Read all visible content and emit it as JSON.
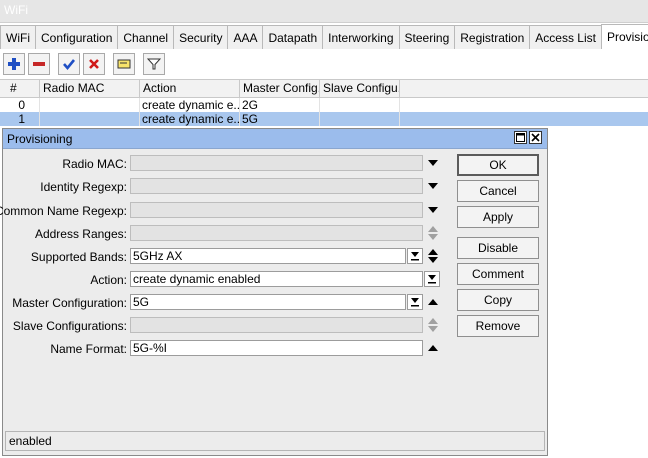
{
  "window": {
    "title": "WiFi"
  },
  "tabs": [
    {
      "label": "WiFi"
    },
    {
      "label": "Configuration"
    },
    {
      "label": "Channel"
    },
    {
      "label": "Security"
    },
    {
      "label": "AAA"
    },
    {
      "label": "Datapath"
    },
    {
      "label": "Interworking"
    },
    {
      "label": "Steering"
    },
    {
      "label": "Registration"
    },
    {
      "label": "Access List"
    },
    {
      "label": "Provisioning",
      "active": true
    }
  ],
  "toolbar": {
    "buttons": [
      "add-icon",
      "remove-icon",
      "enable-icon",
      "disable-icon",
      "comment-icon",
      "filter-icon"
    ]
  },
  "table": {
    "columns": [
      "#",
      "Radio MAC",
      "Action",
      "Master Config...",
      "Slave Configu..."
    ],
    "rows": [
      {
        "num": "0",
        "radio_mac": "",
        "action": "create dynamic e...",
        "master": "2G",
        "slave": ""
      },
      {
        "num": "1",
        "radio_mac": "",
        "action": "create dynamic e...",
        "master": "5G",
        "slave": "",
        "selected": true
      }
    ]
  },
  "dialog": {
    "title": "Provisioning",
    "fields": {
      "radio_mac": {
        "label": "Radio MAC:",
        "value": ""
      },
      "identity_regexp": {
        "label": "Identity Regexp:",
        "value": ""
      },
      "common_name_regexp": {
        "label": "Common Name Regexp:",
        "value": ""
      },
      "address_ranges": {
        "label": "Address Ranges:",
        "value": ""
      },
      "supported_bands": {
        "label": "Supported Bands:",
        "value": "5GHz AX"
      },
      "action": {
        "label": "Action:",
        "value": "create dynamic enabled"
      },
      "master_configuration": {
        "label": "Master Configuration:",
        "value": "5G"
      },
      "slave_configurations": {
        "label": "Slave Configurations:",
        "value": ""
      },
      "name_format": {
        "label": "Name Format:",
        "value": "5G-%I"
      }
    },
    "buttons": {
      "ok": "OK",
      "cancel": "Cancel",
      "apply": "Apply",
      "disable": "Disable",
      "comment": "Comment",
      "copy": "Copy",
      "remove": "Remove"
    },
    "status": "enabled"
  },
  "colors": {
    "dialog_title_bg": "#9bbcec",
    "selected_row_bg": "#a9c7ee",
    "add_icon": "#1f4fc4",
    "remove_icon": "#c62828",
    "enable_icon": "#1f4fc4",
    "disable_icon": "#d01919"
  }
}
